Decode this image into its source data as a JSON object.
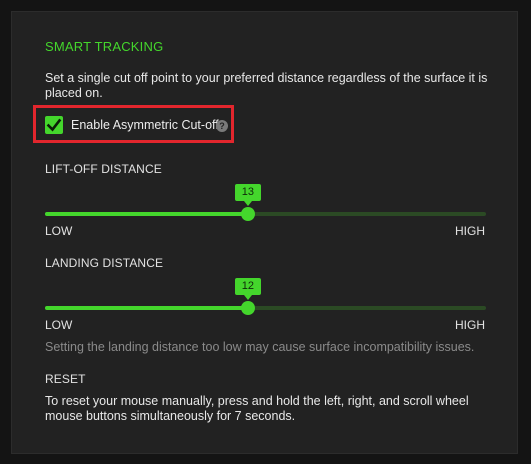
{
  "smart_tracking": {
    "title": "SMART TRACKING",
    "description": "Set a single cut off point to your preferred distance regardless of the surface it is placed on.",
    "asymmetric": {
      "label": "Enable Asymmetric Cut-off",
      "checked": true,
      "help_icon": "help-icon",
      "help_glyph": "?"
    }
  },
  "lift_off": {
    "label": "LIFT-OFF DISTANCE",
    "value": "13",
    "level": 0.46,
    "low_label": "LOW",
    "high_label": "HIGH"
  },
  "landing": {
    "label": "LANDING DISTANCE",
    "value": "12",
    "level": 0.46,
    "low_label": "LOW",
    "high_label": "HIGH",
    "warning": "Setting the landing distance too low may cause surface incompatibility issues."
  },
  "reset": {
    "label": "RESET",
    "description": "To reset your mouse manually, press and hold the left, right, and scroll wheel mouse buttons simultaneously for 7 seconds."
  },
  "colors": {
    "accent": "#44d62c",
    "highlight": "#e2262d",
    "panel": "#222222",
    "background": "#141414"
  }
}
